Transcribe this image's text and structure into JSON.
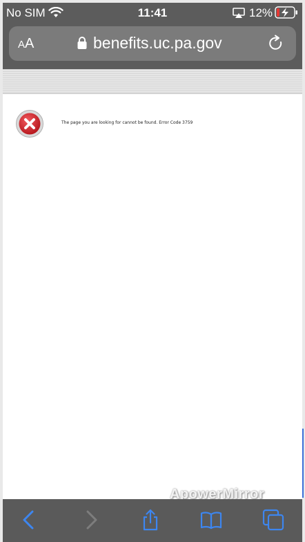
{
  "status_bar": {
    "carrier": "No SIM",
    "time": "11:41",
    "battery_percent": "12%"
  },
  "address_bar": {
    "text_size_small": "A",
    "text_size_large": "A",
    "domain": "benefits.uc.pa.gov"
  },
  "page": {
    "error_message": "The page you are looking for cannot be found. Error Code 3759"
  },
  "watermark": {
    "text": "ApowerMirror"
  },
  "icons": {
    "wifi": "wifi-icon",
    "airplay": "airplay-icon",
    "battery": "battery-charging-icon",
    "lock": "lock-icon",
    "reload": "reload-icon",
    "error": "error-x-icon",
    "back": "chevron-left-icon",
    "forward": "chevron-right-icon",
    "share": "share-icon",
    "bookmarks": "book-icon",
    "tabs": "tabs-icon"
  },
  "colors": {
    "chrome_bg": "#5c5c5c",
    "address_bg": "#7b7b7b",
    "toolbar_accent": "#3d86f0",
    "error_red": "#d8262b",
    "battery_low": "#e53935"
  }
}
